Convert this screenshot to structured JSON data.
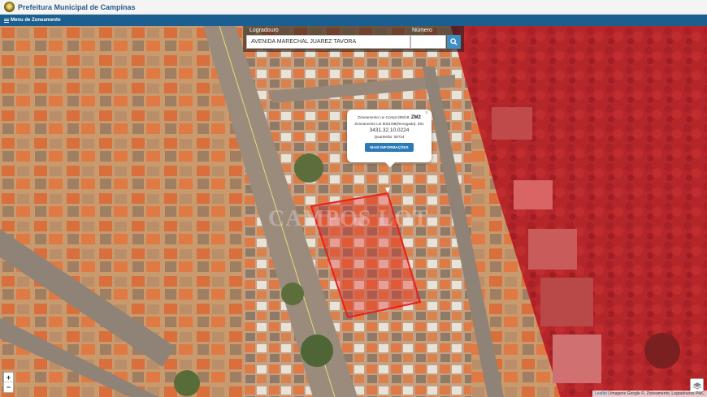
{
  "header": {
    "title": "Prefeitura Municipal de Campinas"
  },
  "menu": {
    "label": "Menu de Zoneamento"
  },
  "search": {
    "logradouro_label": "Logradouro",
    "numero_label": "Número",
    "logradouro_value": "AVENIDA MARECHAL JUAREZ TAVORA",
    "numero_value": "",
    "search_icon": "search-icon"
  },
  "popup": {
    "line1_prefix": "Zoneamento Lei Compl.208/18: ",
    "line1_zone": "ZM2",
    "line2": "Zoneamento Lei 6031/88(Revogada): Z01",
    "code": "3431.32.10.0224",
    "quarteirao": "Quarteirão: 00724",
    "button": "MAIS INFORMAÇÕES",
    "close": "×"
  },
  "zoom": {
    "in": "+",
    "out": "−"
  },
  "attribution": {
    "leaflet": "Leaflet",
    "rest": " | Imagens Google ©, Zoneamento, Logradouros PMC"
  },
  "watermark": "CAMPOS LOT",
  "colors": {
    "header_blue": "#1a5f8f",
    "zone_red": "#d9232b",
    "parcel_outline": "#e8201c",
    "button_blue": "#2a7ab8"
  }
}
